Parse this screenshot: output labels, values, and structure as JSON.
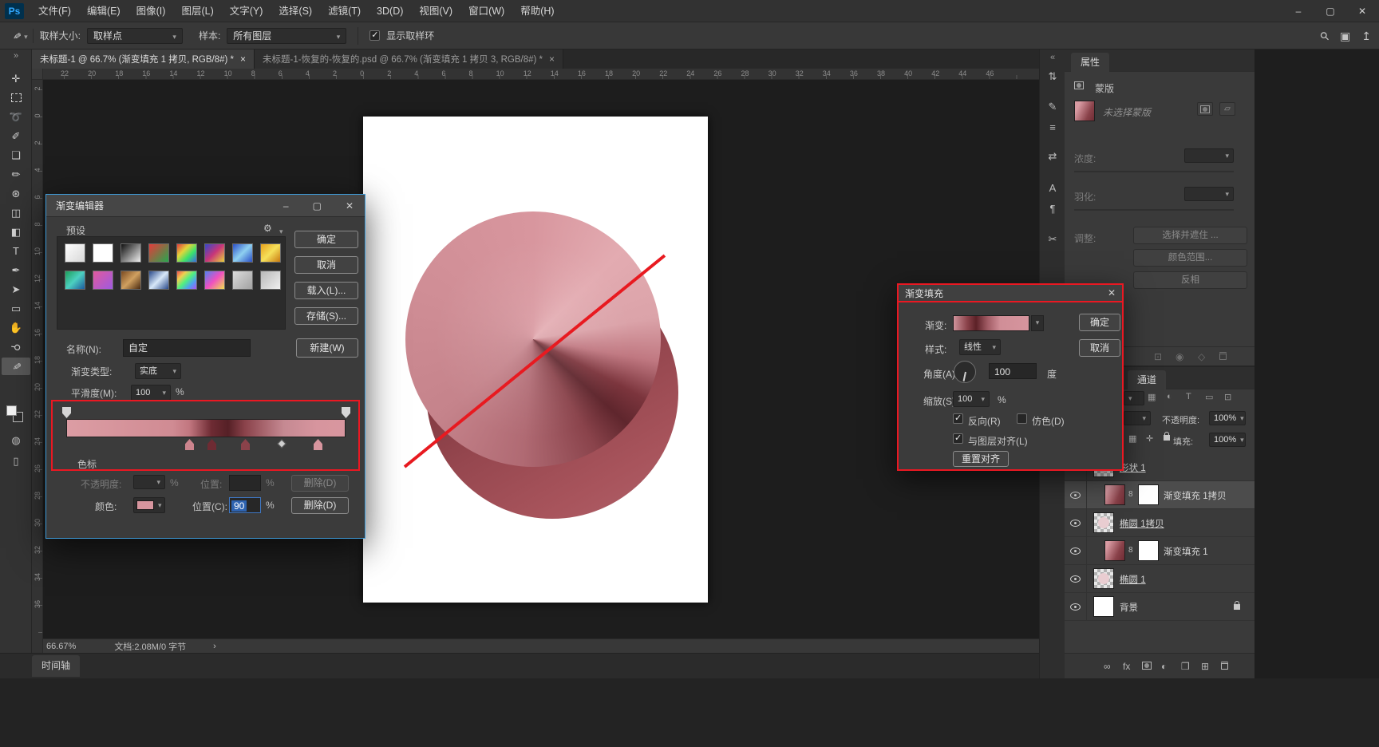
{
  "app": {
    "logo": "Ps",
    "menu": [
      "文件(F)",
      "编辑(E)",
      "图像(I)",
      "图层(L)",
      "文字(Y)",
      "选择(S)",
      "滤镜(T)",
      "3D(D)",
      "视图(V)",
      "窗口(W)",
      "帮助(H)"
    ],
    "window_controls": [
      "–",
      "▢",
      "✕"
    ]
  },
  "options_bar": {
    "tool_icon": {
      "name": "eyedropper-icon",
      "glyph": "✎"
    },
    "sample_size_label": "取样大小:",
    "sample_size_value": "取样点",
    "sample_label": "样本:",
    "sample_value": "所有图层",
    "show_ring_label": "显示取样环",
    "show_ring_checked": true,
    "right_icons": [
      {
        "name": "search-icon",
        "glyph": "⚲",
        "rot": true
      },
      {
        "name": "workspace-icon",
        "glyph": "▣"
      },
      {
        "name": "share-icon",
        "glyph": "↥"
      }
    ]
  },
  "toolbar": {
    "collapse": "»",
    "tools": [
      {
        "name": "move-tool",
        "glyph": "✛"
      },
      {
        "name": "marquee-tool",
        "shape": "marquee"
      },
      {
        "name": "lasso-tool",
        "glyph": "➰"
      },
      {
        "name": "quick-selection-tool",
        "glyph": "✐"
      },
      {
        "name": "crop-tool",
        "glyph": "❑"
      },
      {
        "name": "brush-tool",
        "glyph": "✏"
      },
      {
        "name": "clone-stamp-tool",
        "glyph": "⊛"
      },
      {
        "name": "eraser-tool",
        "glyph": "◫"
      },
      {
        "name": "paint-bucket-tool",
        "glyph": "◧"
      },
      {
        "name": "type-tool",
        "glyph": "T"
      },
      {
        "name": "pen-tool",
        "glyph": "✒"
      },
      {
        "name": "path-selection-tool",
        "glyph": "➤"
      },
      {
        "name": "shape-tool",
        "glyph": "▭"
      },
      {
        "name": "hand-tool",
        "glyph": "✋"
      },
      {
        "name": "zoom-tool",
        "glyph": "⚲",
        "rot": true
      },
      {
        "name": "eyedropper-tool",
        "glyph": "✎",
        "rot": true,
        "selected": true
      }
    ],
    "quick_mask_icon": "◍",
    "screen_mode_icon": "▯"
  },
  "document_tabs": [
    {
      "title": "未标题-1 @ 66.7% (渐变填充 1 拷贝, RGB/8#) *",
      "close": "×",
      "active": true
    },
    {
      "title": "未标题-1-恢复的-恢复的.psd @ 66.7% (渐变填充 1 拷贝 3, RGB/8#) *",
      "close": "×",
      "active": false
    }
  ],
  "rulers": {
    "horizontal": [
      22,
      20,
      18,
      16,
      14,
      12,
      10,
      8,
      6,
      4,
      2,
      0,
      2,
      4,
      6,
      8,
      10,
      12,
      14,
      16,
      18,
      20,
      22,
      24,
      26,
      28,
      30,
      32,
      34,
      36,
      38,
      40,
      42,
      44,
      46
    ],
    "vertical": [
      2,
      0,
      2,
      4,
      6,
      8,
      10,
      12,
      14,
      16,
      18,
      20,
      22,
      24,
      26,
      28,
      30,
      32,
      34,
      36
    ]
  },
  "canvas": {
    "red_line_color": "#e81a20",
    "front_circle": "conic-gradient(from 0deg at 50% 50%, #d8969e 0deg, #e3abb1 45deg, #dba3a9 80deg, #c07881 100deg, #7c353d 118deg, #5f262d 132deg, #8a434b 150deg, #b06a73 185deg, #c5838b 230deg, #cf8d95 290deg, #d8969e 360deg)",
    "back_circle": "linear-gradient(150deg, #6b2a31 10%, #96474f 55%, #a8545c 80%, #b0616a 100%)"
  },
  "status_bar": {
    "zoom": "66.67%",
    "doc": "文档:2.08M/0 字节",
    "chevron": "›"
  },
  "timeline": {
    "tab": "时间轴"
  },
  "dock_expand": "«",
  "dock_icons": [
    {
      "name": "dock-adjustments-icon",
      "glyph": "⇅"
    },
    {
      "name": "dock-styles-icon",
      "glyph": "✎"
    },
    {
      "name": "dock-info-icon",
      "glyph": "≡"
    },
    {
      "name": "dock-swatches-icon",
      "glyph": "⇄"
    },
    {
      "name": "dock-character-icon",
      "glyph": "A"
    },
    {
      "name": "dock-paragraph-icon",
      "glyph": "¶"
    },
    {
      "name": "dock-scissors-icon",
      "glyph": "✂"
    }
  ],
  "properties": {
    "tab": "属性",
    "mask_label": "蒙版",
    "mask_status": "未选择蒙版",
    "thumb_gradient": "linear-gradient(115deg, #d89aa2 20%, #8a424a 70%, #6e2b33)",
    "density_label": "浓度:",
    "feather_label": "羽化:",
    "refine_label": "调整:",
    "select_mask_button": "选择并遮住 ...",
    "color_range_button": "颜色范围...",
    "invert_button": "反相",
    "mask_header_icons": [
      {
        "name": "pixel-mask-icon",
        "css": "maskic"
      },
      {
        "name": "vector-mask-icon",
        "glyph": "▱"
      }
    ],
    "footer_icons": [
      {
        "name": "load-selection-icon",
        "glyph": "⊡"
      },
      {
        "name": "apply-mask-icon",
        "glyph": "◉"
      },
      {
        "name": "toggle-mask-icon",
        "glyph": "◇"
      },
      {
        "name": "delete-mask-icon",
        "css": "trash"
      }
    ]
  },
  "layers": {
    "channels_tab": "通道",
    "filter_icons": [
      {
        "name": "filter-pixel-icon",
        "glyph": "▦"
      },
      {
        "name": "filter-adjustment-icon",
        "glyph": "◐"
      },
      {
        "name": "filter-type-icon",
        "glyph": "T"
      },
      {
        "name": "filter-shape-icon",
        "glyph": "▭"
      },
      {
        "name": "filter-smart-icon",
        "glyph": "⊡"
      }
    ],
    "opacity_label": "不透明度:",
    "opacity_value": "100%",
    "fill_label": "填充:",
    "fill_value": "100%",
    "lock_icons": [
      {
        "name": "lock-transparency-icon",
        "glyph": "▦"
      },
      {
        "name": "lock-position-icon",
        "glyph": "✛"
      },
      {
        "name": "lock-all-icon",
        "css": "lock"
      }
    ],
    "link_glyph": "8",
    "fill_thumb_gradient": "linear-gradient(115deg, #d89aa2 15%, #8a424a 65%, #6e2b33)",
    "rows": [
      {
        "name": "形状 1",
        "type": "shape",
        "underline": true
      },
      {
        "name": "渐变填充 1拷贝",
        "type": "fill",
        "selected": true
      },
      {
        "name": "椭圆 1拷贝",
        "type": "shape",
        "underline": true
      },
      {
        "name": "渐变填充 1",
        "type": "fill"
      },
      {
        "name": "椭圆 1",
        "type": "shape",
        "underline": true
      },
      {
        "name": "背景",
        "type": "background",
        "locked": true
      }
    ],
    "footer_icons": [
      {
        "name": "link-layers-icon",
        "glyph": "∞"
      },
      {
        "name": "layer-effects-icon",
        "glyph": "fx"
      },
      {
        "name": "add-mask-icon",
        "css": "maskic"
      },
      {
        "name": "adjustment-layer-icon",
        "glyph": "◐"
      },
      {
        "name": "new-group-icon",
        "glyph": "❒"
      },
      {
        "name": "new-layer-icon",
        "glyph": "⊞"
      },
      {
        "name": "delete-layer-icon",
        "css": "trash"
      }
    ]
  },
  "gradient_editor": {
    "title": "渐变编辑器",
    "window_controls": [
      "–",
      "▢",
      "✕"
    ],
    "presets_label": "预设",
    "gear_icon": "⚙",
    "preset_swatches": [
      {
        "g": "linear-gradient(135deg,#fdfdfd,#d8d8d8)"
      },
      {
        "g": "linear-gradient(135deg,#ffffff 30%,rgba(255,255,255,0))",
        "checker": true
      },
      {
        "g": "linear-gradient(135deg,#101010,#f0f0f0)"
      },
      {
        "g": "linear-gradient(135deg,#e23b3b,#27a84e)"
      },
      {
        "g": "linear-gradient(135deg,#e23b3b,#e2d53b 35%,#3be26a 65%,#3b6ae2)"
      },
      {
        "g": "linear-gradient(135deg,#3548c8,#c83579 50%,#e8d23c)"
      },
      {
        "g": "linear-gradient(135deg,#2c50c8,#8fd0f0 50%,#2c50c8)"
      },
      {
        "g": "linear-gradient(135deg,#e8a11c,#f5e05a 50%,#c87a10)"
      },
      {
        "g": "linear-gradient(135deg,#1d9e5a,#4cd0c0 50%,#1d5a9e)"
      },
      {
        "g": "linear-gradient(135deg,#e05a9e,#9e5ae0)"
      },
      {
        "g": "linear-gradient(135deg,#7a4a20,#d0a060 50%,#4a2a10)"
      },
      {
        "g": "linear-gradient(135deg,#2a4a8a,#d8e8f8 50%,#2a4a8a)"
      },
      {
        "g": "linear-gradient(135deg,#f05050,#f0d050 25%,#50f080 50%,#50a0f0 75%,#b050f0)"
      },
      {
        "g": "linear-gradient(135deg,#5080f0,#f050c0 50%,#f0e050)"
      },
      {
        "g": "linear-gradient(135deg,rgba(200,200,200,0.7),rgba(110,110,110,0.7))",
        "checker": true
      },
      {
        "g": "linear-gradient(135deg,#b8b8b8,#f0f0f0)"
      }
    ],
    "ok_button": "确定",
    "cancel_button": "取消",
    "load_button": "载入(L)...",
    "save_button": "存储(S)...",
    "name_label": "名称(N):",
    "name_value": "自定",
    "new_button": "新建(W)",
    "type_label": "渐变类型:",
    "type_value": "实底",
    "smoothness_label": "平滑度(M):",
    "smoothness_value": "100",
    "percent": "%",
    "strip_gradient": "linear-gradient(90deg,#dc9da4 0%,#d08b93 38%,#c27780 44%,#6e2b33 52%,#552026 58%,#8a424a 64%,#c58992 78%,#d7959e 90%,#d8969f 100%)",
    "opacity_stops": [
      0,
      100
    ],
    "color_stops": [
      {
        "pos": 44,
        "color": "#cc848d"
      },
      {
        "pos": 52,
        "color": "#6e2b33"
      },
      {
        "pos": 64,
        "color": "#8a424a"
      },
      {
        "pos": 90,
        "color": "#d7959e",
        "selected": true
      }
    ],
    "midpoint": 77,
    "stops_label": "色标",
    "opacity_row": {
      "label": "不透明度:",
      "percent": "%",
      "position_label": "位置:",
      "delete_button": "删除(D)"
    },
    "color_row": {
      "label": "颜色:",
      "swatch_color": "#d7959e",
      "position_label": "位置(C):",
      "position_value": "90",
      "percent": "%",
      "delete_button": "删除(D)"
    }
  },
  "gradient_fill": {
    "title": "渐变填充",
    "close": "✕",
    "gradient_label": "渐变:",
    "gradient_preview": "linear-gradient(90deg,#cf939b 0%,#8a424a 18%,#5c2127 30%,#a05a63 45%,#d08e97 62%,#d6959e 100%)",
    "ok_button": "确定",
    "cancel_button": "取消",
    "style_label": "样式:",
    "style_value": "线性",
    "angle_label": "角度(A):",
    "angle_value": "100",
    "angle_unit": "度",
    "scale_label": "缩放(S):",
    "scale_value": "100",
    "percent": "%",
    "reverse_label": "反向(R)",
    "reverse_checked": true,
    "dither_label": "仿色(D)",
    "dither_checked": false,
    "align_label": "与图层对齐(L)",
    "align_checked": true,
    "reset_button": "重置对齐"
  }
}
